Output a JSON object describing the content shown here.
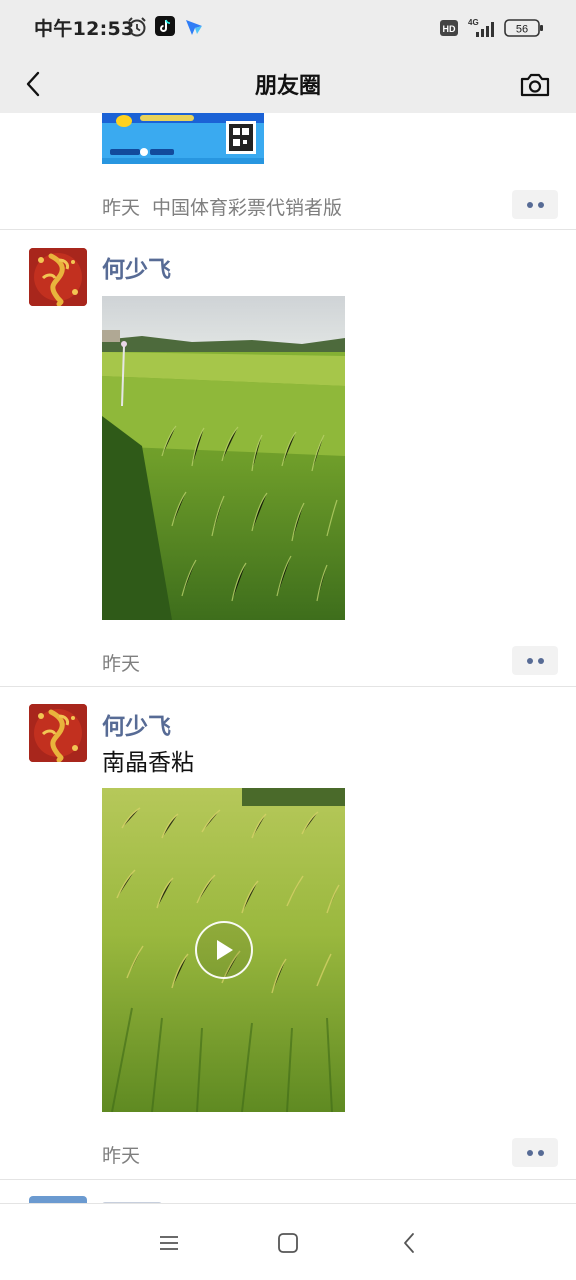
{
  "status_bar": {
    "time": "中午12:53",
    "icons": [
      "alarm-icon",
      "tiktok-icon",
      "app-notification-icon"
    ],
    "hd_badge": "HD",
    "network": "4G",
    "battery": "56"
  },
  "header": {
    "title": "朋友圈",
    "back_icon": "back-chevron-icon",
    "camera_icon": "camera-icon"
  },
  "feed": {
    "partial_post": {
      "time": "昨天",
      "source": "中国体育彩票代销者版"
    },
    "posts": [
      {
        "author": "何少飞",
        "text": "",
        "media_type": "image",
        "time": "昨天"
      },
      {
        "author": "何少飞",
        "text": "南晶香粘",
        "media_type": "video",
        "time": "昨天"
      }
    ]
  },
  "nav": {
    "icons": [
      "menu-icon",
      "home-icon",
      "back-icon"
    ]
  },
  "colors": {
    "author_link": "#576b95",
    "header_bg": "#ededed",
    "time_gray": "#7f7f7f"
  }
}
